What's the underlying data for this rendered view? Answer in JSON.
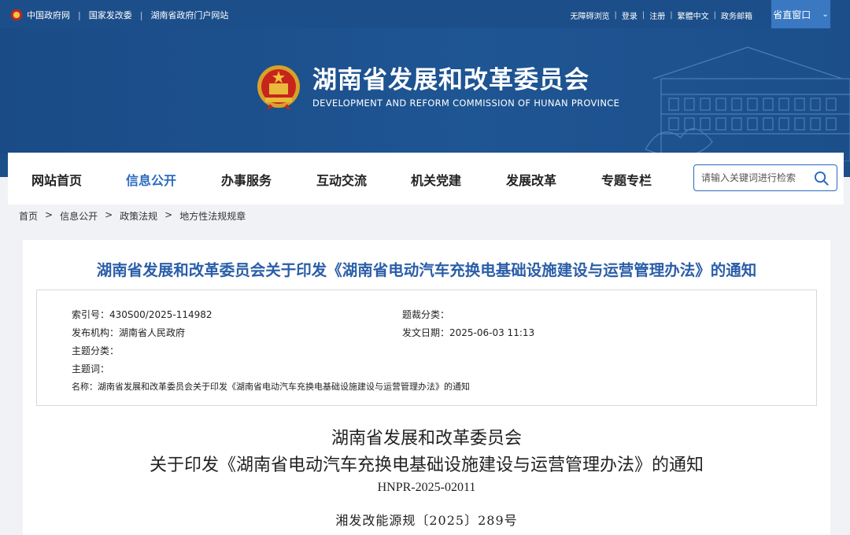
{
  "topbar": {
    "links_left": [
      "中国政府网",
      "国家发改委",
      "湖南省政府门户网站"
    ],
    "links_right": [
      "无障碍浏览",
      "登录",
      "注册",
      "繁體中文",
      "政务邮箱"
    ],
    "dept_button": "省直窗口"
  },
  "brand": {
    "name_cn": "湖南省发展和改革委员会",
    "name_en": "DEVELOPMENT AND REFORM COMMISSION OF HUNAN PROVINCE"
  },
  "nav": {
    "items": [
      "网站首页",
      "信息公开",
      "办事服务",
      "互动交流",
      "机关党建",
      "发展改革",
      "专题专栏"
    ],
    "active_index": 1,
    "search_placeholder": "请输入关键词进行检索"
  },
  "breadcrumb": [
    "首页",
    "信息公开",
    "政策法规",
    "地方性法规规章"
  ],
  "document": {
    "title": "湖南省发展和改革委员会关于印发《湖南省电动汽车充换电基础设施建设与运营管理办法》的通知",
    "meta": {
      "index_no": "索引号：430S00/2025-114982",
      "category": "题裁分类：",
      "publisher": "发布机构：湖南省人民政府",
      "date": "发文日期：2025-06-03 11:13",
      "topic_class": "主题分类：",
      "keywords": "主题词：",
      "name": "名称：湖南省发展和改革委员会关于印发《湖南省电动汽车充换电基础设施建设与运营管理办法》的通知"
    },
    "heading_line1": "湖南省发展和改革委员会",
    "heading_line2": "关于印发《湖南省电动汽车充换电基础设施建设与运营管理办法》的通知",
    "code": "HNPR-2025-02011",
    "doc_number": "湘发改能源规〔2025〕289号"
  },
  "colors": {
    "header_blue": "#1c4f8a",
    "accent_blue": "#2b6bbf",
    "title_blue": "#2b5ea8"
  }
}
